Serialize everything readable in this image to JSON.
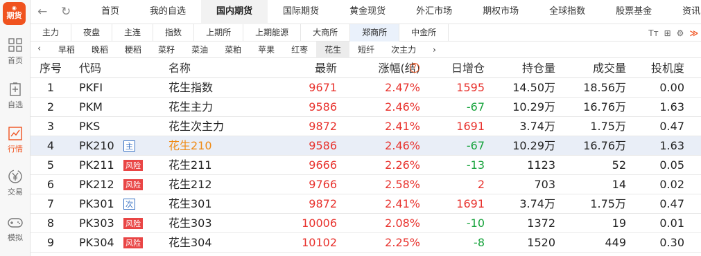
{
  "app": {
    "logo_top": "◉",
    "logo_text": "期货",
    "sidebar": [
      {
        "label": "首页",
        "icon": "home-grid-icon"
      },
      {
        "label": "自选",
        "icon": "watchlist-icon"
      },
      {
        "label": "行情",
        "icon": "chart-icon"
      },
      {
        "label": "交易",
        "icon": "trade-yen-icon"
      },
      {
        "label": "模拟",
        "icon": "gamepad-icon"
      }
    ],
    "colors": {
      "accent": "#f0521e",
      "up": "#e8312c",
      "down": "#17a33c",
      "highlight": "#ef8a14",
      "tag_blue": "#3a73c4"
    }
  },
  "nav": {
    "back": "←",
    "refresh": "↻",
    "tabs": [
      "首页",
      "我的自选",
      "国内期货",
      "国际期货",
      "黄金现货",
      "外汇市场",
      "期权市场",
      "全球指数",
      "股票基金",
      "资讯中心"
    ],
    "active": 2
  },
  "exchanges": {
    "tabs": [
      "主力",
      "夜盘",
      "主连",
      "指数",
      "上期所",
      "上期能源",
      "大商所",
      "郑商所",
      "中金所"
    ],
    "active": 7,
    "tools": {
      "font": "Tт",
      "grid": "⊞",
      "settings": "⚙",
      "more": "≫"
    }
  },
  "varieties": {
    "left_arrow": "‹",
    "right_arrow": "›",
    "tabs": [
      "早稻",
      "晚稻",
      "粳稻",
      "菜籽",
      "菜油",
      "菜粕",
      "苹果",
      "红枣",
      "花生",
      "短纤",
      "次主力"
    ],
    "active": 8
  },
  "table": {
    "headers": {
      "seq": "序号",
      "code": "代码",
      "name": "名称",
      "last": "最新",
      "chg": "涨幅(结)",
      "help": "?",
      "oi": "日增仓",
      "hold": "持仓量",
      "vol": "成交量",
      "spec": "投机度"
    },
    "rows": [
      {
        "seq": "1",
        "code": "PKFI",
        "tag": "",
        "name": "花生指数",
        "last": "9671",
        "chg": "2.47%",
        "oi": "1595",
        "hold": "14.50万",
        "vol": "18.56万",
        "spec": "0.00"
      },
      {
        "seq": "2",
        "code": "PKM",
        "tag": "",
        "name": "花生主力",
        "last": "9586",
        "chg": "2.46%",
        "oi": "-67",
        "hold": "10.29万",
        "vol": "16.76万",
        "spec": "1.63"
      },
      {
        "seq": "3",
        "code": "PKS",
        "tag": "",
        "name": "花生次主力",
        "last": "9872",
        "chg": "2.41%",
        "oi": "1691",
        "hold": "3.74万",
        "vol": "1.75万",
        "spec": "0.47"
      },
      {
        "seq": "4",
        "code": "PK210",
        "tag": "主",
        "name": "花生210",
        "last": "9586",
        "chg": "2.46%",
        "oi": "-67",
        "hold": "10.29万",
        "vol": "16.76万",
        "spec": "1.63"
      },
      {
        "seq": "5",
        "code": "PK211",
        "tag": "风险",
        "name": "花生211",
        "last": "9666",
        "chg": "2.26%",
        "oi": "-13",
        "hold": "1123",
        "vol": "52",
        "spec": "0.05"
      },
      {
        "seq": "6",
        "code": "PK212",
        "tag": "风险",
        "name": "花生212",
        "last": "9766",
        "chg": "2.58%",
        "oi": "2",
        "hold": "703",
        "vol": "14",
        "spec": "0.02"
      },
      {
        "seq": "7",
        "code": "PK301",
        "tag": "次",
        "name": "花生301",
        "last": "9872",
        "chg": "2.41%",
        "oi": "1691",
        "hold": "3.74万",
        "vol": "1.75万",
        "spec": "0.47"
      },
      {
        "seq": "8",
        "code": "PK303",
        "tag": "风险",
        "name": "花生303",
        "last": "10006",
        "chg": "2.08%",
        "oi": "-10",
        "hold": "1372",
        "vol": "19",
        "spec": "0.01"
      },
      {
        "seq": "9",
        "code": "PK304",
        "tag": "风险",
        "name": "花生304",
        "last": "10102",
        "chg": "2.25%",
        "oi": "-8",
        "hold": "1520",
        "vol": "449",
        "spec": "0.30"
      }
    ],
    "selected_row": 3
  }
}
